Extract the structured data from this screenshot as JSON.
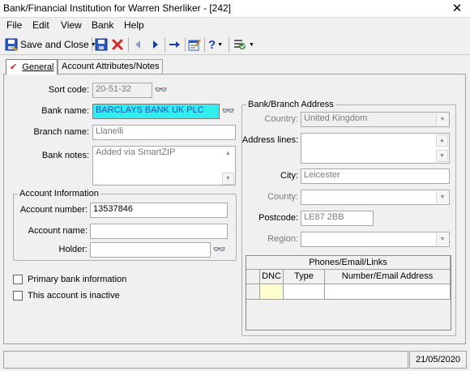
{
  "window": {
    "title": "Bank/Financial Institution for Warren Sherliker - [242]",
    "close_glyph": "✕"
  },
  "menu": [
    "File",
    "Edit",
    "View",
    "Bank",
    "Help"
  ],
  "toolbar": {
    "save_close_label": "Save and Close"
  },
  "tabs": {
    "general": "General",
    "attributes": "Account Attributes/Notes"
  },
  "form": {
    "sort_code_label": "Sort code:",
    "sort_code_value": "20-51-32",
    "bank_name_label": "Bank name:",
    "bank_name_value": "BARCLAYS BANK UK PLC",
    "branch_name_label": "Branch name:",
    "branch_name_value": "Llanelli",
    "bank_notes_label": "Bank notes:",
    "bank_notes_value": "Added via SmartZIP"
  },
  "account_info": {
    "title": "Account Information",
    "number_label": "Account number:",
    "number_value": "13537846",
    "name_label": "Account name:",
    "name_value": "",
    "holder_label": "Holder:",
    "holder_value": ""
  },
  "checkboxes": {
    "primary": "Primary bank information",
    "inactive": "This account is inactive"
  },
  "address": {
    "title": "Bank/Branch Address",
    "country_label": "Country:",
    "country_value": "United Kingdom",
    "lines_label": "Address lines:",
    "lines_value": "",
    "city_label": "City:",
    "city_value": "Leicester",
    "county_label": "County:",
    "county_value": "",
    "postcode_label": "Postcode:",
    "postcode_value": "LE87 2BB",
    "region_label": "Region:",
    "region_value": ""
  },
  "phones": {
    "title": "Phones/Email/Links",
    "columns": [
      "DNC",
      "Type",
      "Number/Email Address"
    ]
  },
  "status": {
    "date": "21/05/2020"
  }
}
